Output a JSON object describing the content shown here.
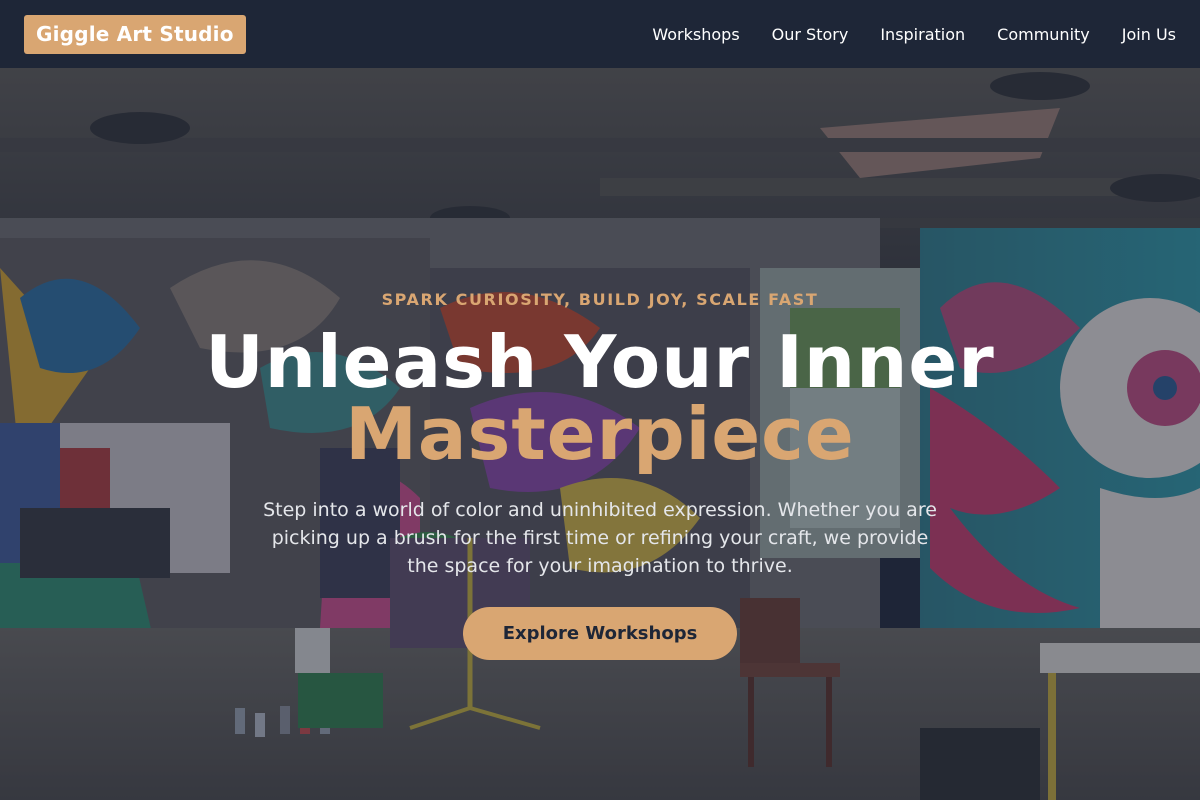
{
  "brand": {
    "name": "Giggle Art Studio"
  },
  "nav": {
    "items": [
      {
        "label": "Workshops"
      },
      {
        "label": "Our Story"
      },
      {
        "label": "Inspiration"
      },
      {
        "label": "Community"
      },
      {
        "label": "Join Us"
      }
    ]
  },
  "hero": {
    "eyebrow": "SPARK CURIOSITY, BUILD JOY, SCALE FAST",
    "title_line1": "Unleash Your Inner",
    "title_line2": "Masterpiece",
    "subtitle": "Step into a world of color and uninhibited expression. Whether you are picking up a brush for the first time or refining your craft, we provide the space for your imagination to thrive.",
    "cta_label": "Explore Workshops",
    "background_image": "graffiti art studio interior"
  },
  "colors": {
    "navbar_bg": "#1e2637",
    "accent": "#d9a672",
    "text_light": "#ffffff"
  }
}
